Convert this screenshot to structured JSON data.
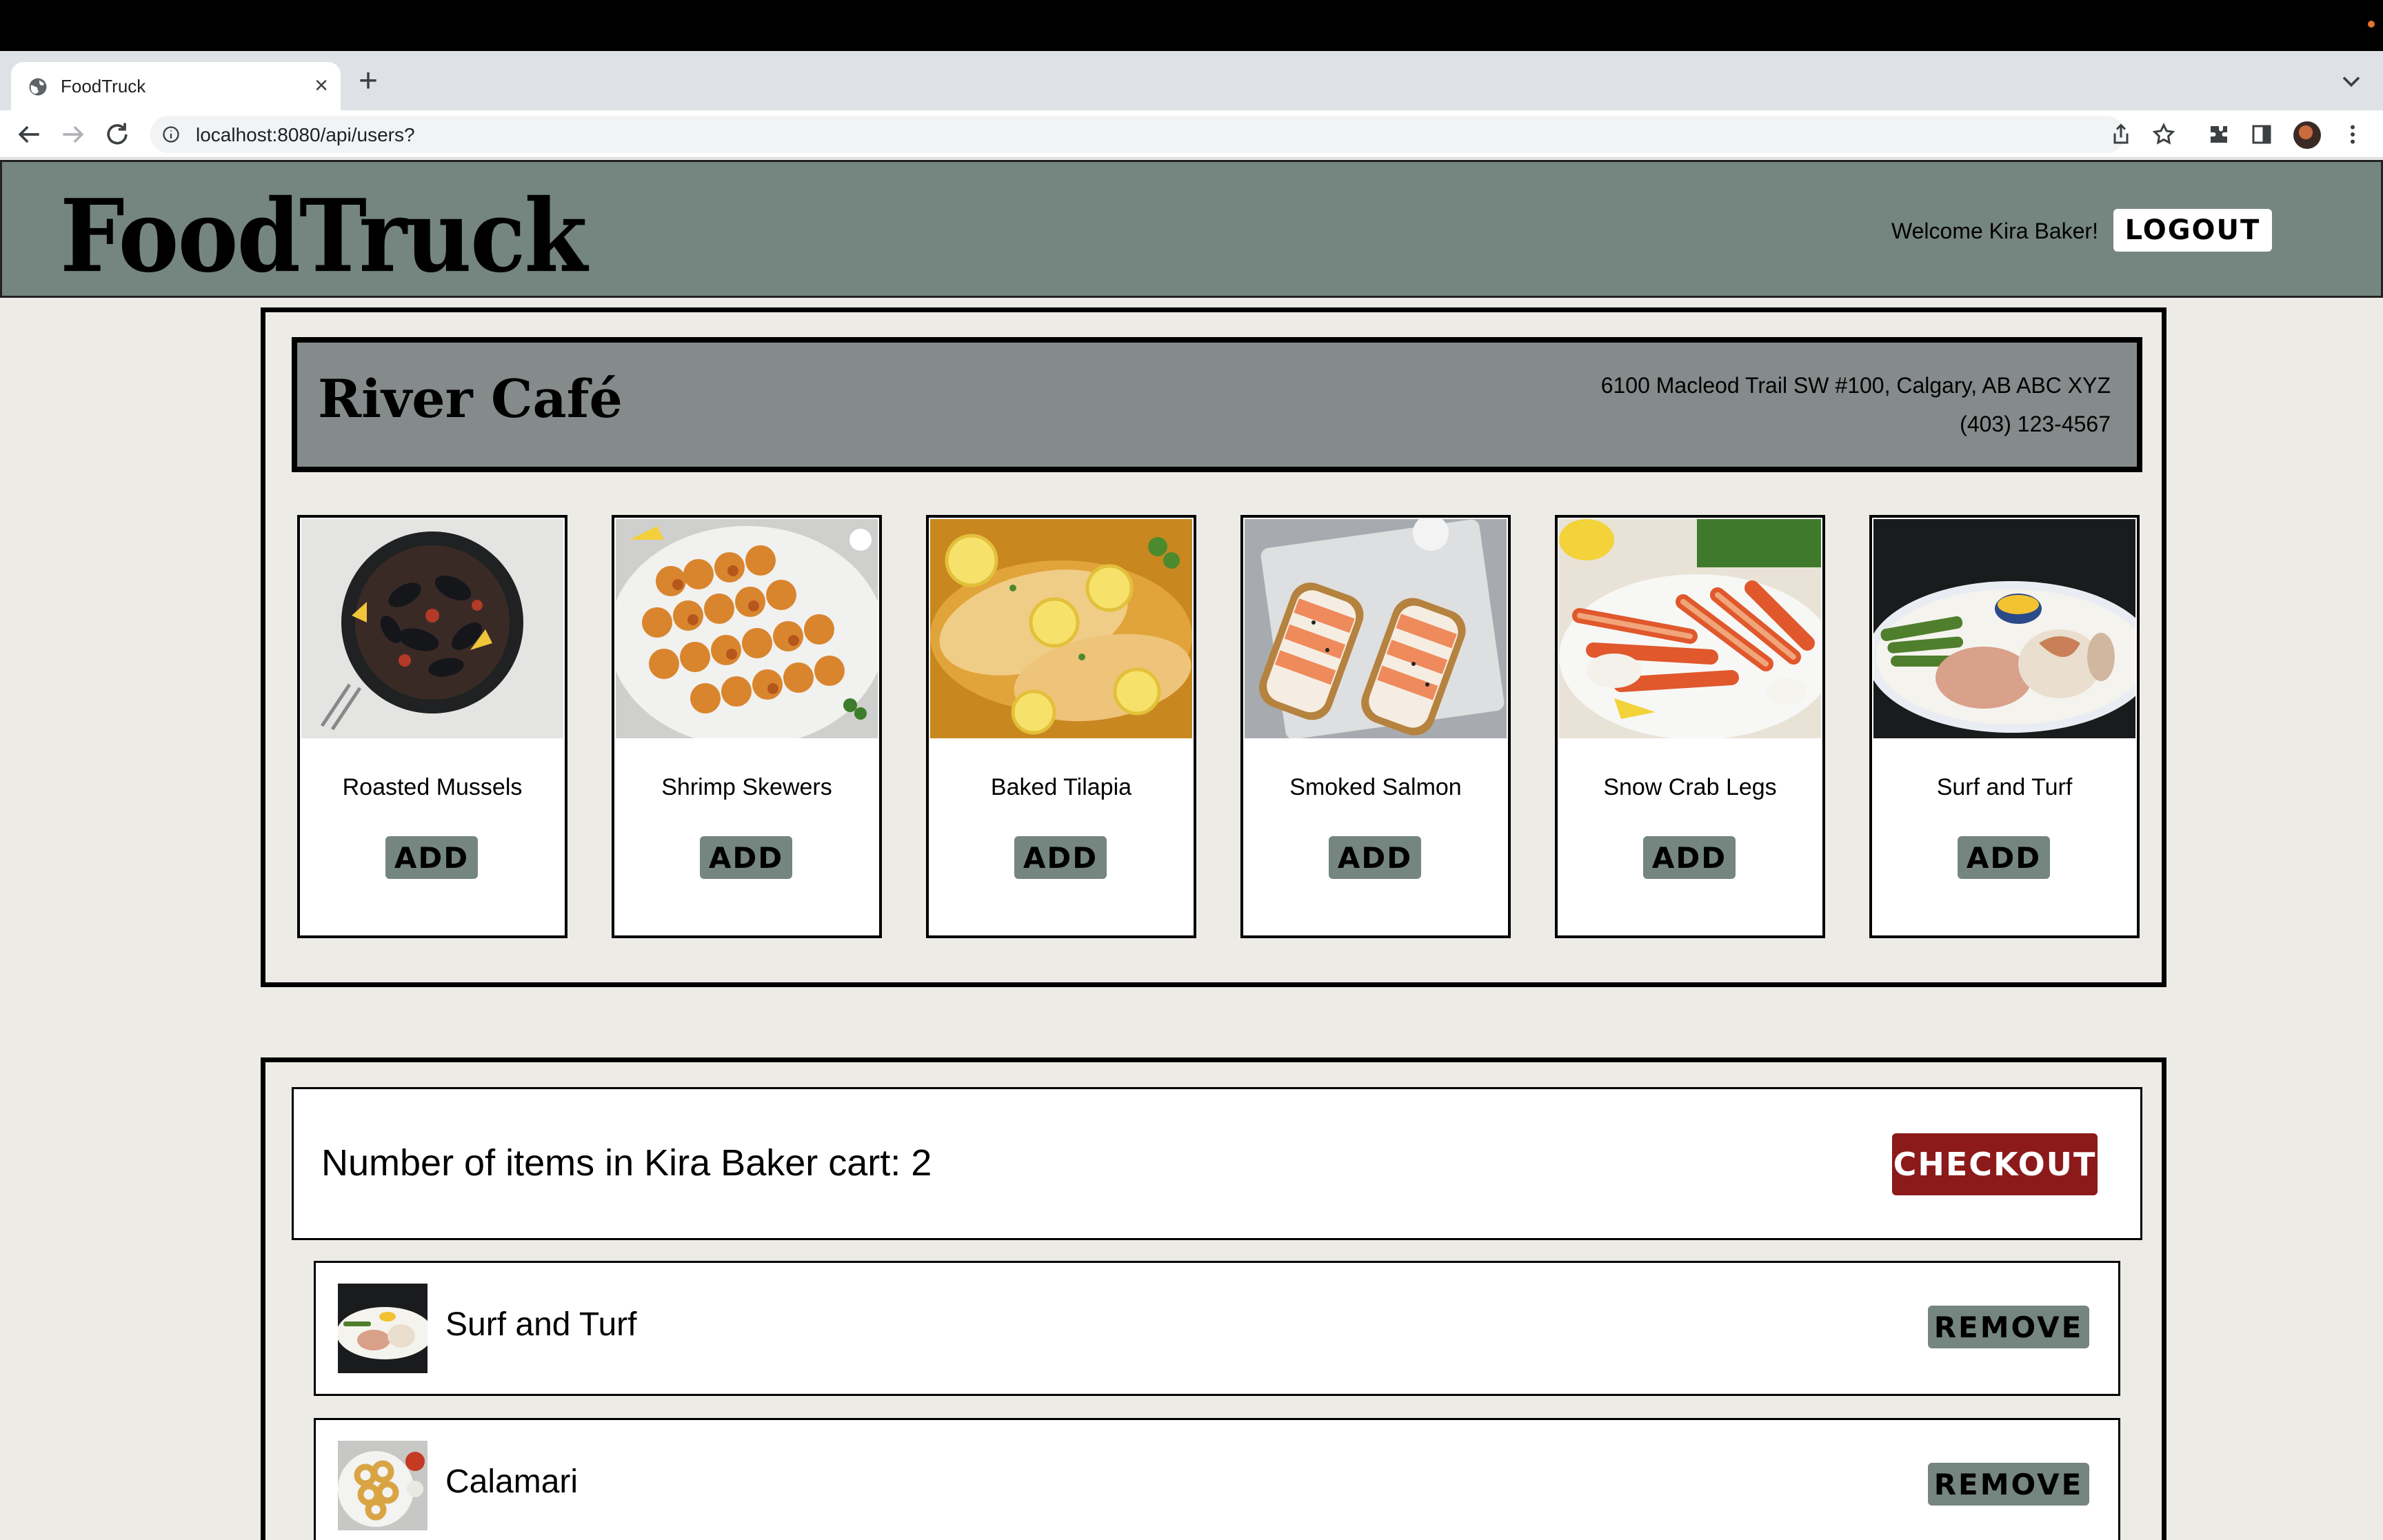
{
  "browser": {
    "tab_title": "FoodTruck",
    "tab_close": "×",
    "new_tab": "+",
    "url": "localhost:8080/api/users?"
  },
  "header": {
    "logo": "FoodTruck",
    "welcome": "Welcome Kira Baker!",
    "logout_label": "LOGOUT"
  },
  "restaurant": {
    "name": "River Café",
    "address": "6100 Macleod Trail SW #100, Calgary, AB ABC XYZ",
    "phone": "(403) 123-4567"
  },
  "menu": [
    {
      "name": "Roasted Mussels",
      "add_label": "ADD"
    },
    {
      "name": "Shrimp Skewers",
      "add_label": "ADD"
    },
    {
      "name": "Baked Tilapia",
      "add_label": "ADD"
    },
    {
      "name": "Smoked Salmon",
      "add_label": "ADD"
    },
    {
      "name": "Snow Crab Legs",
      "add_label": "ADD"
    },
    {
      "name": "Surf and Turf",
      "add_label": "ADD"
    }
  ],
  "cart": {
    "summary": "Number of items in Kira Baker cart: 2",
    "checkout_label": "CHECKOUT",
    "items": [
      {
        "name": "Surf and Turf",
        "remove_label": "REMOVE"
      },
      {
        "name": "Calamari",
        "remove_label": "REMOVE"
      }
    ]
  },
  "colors": {
    "header_bg": "#758580",
    "banner_bg": "#858a8b",
    "page_bg": "#edebe6",
    "checkout_bg": "#8c1a1a"
  }
}
